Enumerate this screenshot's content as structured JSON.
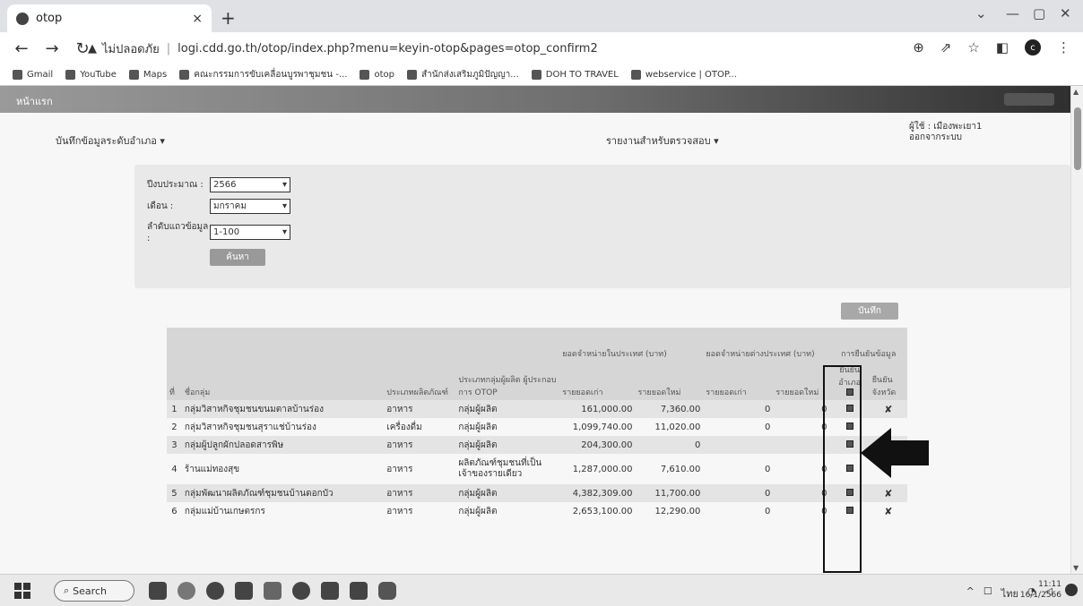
{
  "browser": {
    "tab_title": "otop",
    "close_glyph": "×",
    "new_tab_glyph": "+",
    "url_warning": "ไม่ปลอดภัย",
    "url": "logi.cdd.go.th/otop/index.php?menu=keyin-otop&pages=otop_confirm2",
    "profile_initial": "c"
  },
  "bookmarks": [
    {
      "label": "Gmail"
    },
    {
      "label": "YouTube"
    },
    {
      "label": "Maps"
    },
    {
      "label": "คณะกรรมการขับเคลื่อนบูรพาชุมชน -..."
    },
    {
      "label": "otop"
    },
    {
      "label": "สำนักส่งเสริมภูมิปัญญา..."
    },
    {
      "label": "DOH TO TRAVEL"
    },
    {
      "label": "webservice | OTOP..."
    }
  ],
  "header": {
    "home_label": "หน้าแรก"
  },
  "menu": {
    "left": "บันทึกข้อมูลระดับอำเภอ ▾",
    "center": "รายงานสำหรับตรวจสอบ ▾"
  },
  "user": {
    "line1": "ผู้ใช้ : เมืองพะเยา1",
    "line2": "ออกจากระบบ"
  },
  "filter": {
    "year_label": "ปีงบประมาณ :",
    "year_value": "2566",
    "month_label": "เดือน :",
    "month_value": "มกราคม",
    "range_label": "ลำดับแถวข้อมูล :",
    "range_value": "1-100",
    "search_button": "ค้นหา"
  },
  "save_button": "บันทึก",
  "table": {
    "group_headers": {
      "sales_group": "ยอดจำหน่ายในประเทศ (บาท)",
      "export_group": "ยอดจำหน่ายต่างประเทศ (บาท)",
      "confirm_group": "การยืนยันข้อมูล"
    },
    "headers": [
      "ที่",
      "ชื่อกลุ่ม",
      "ประเภทผลิตภัณฑ์",
      "ประเภทกลุ่มผู้ผลิต ผู้ประกอบการ OTOP",
      "รายยอดเก่า",
      "รายยอดใหม่",
      "รายยอดเก่า",
      "รายยอดใหม่",
      "ยืนยัน อำเภอ",
      "ยืนยัน จังหวัด"
    ],
    "rows": [
      {
        "no": "1",
        "name": "กลุ่มวิสาหกิจชุมชนขนมตาลบ้านร่อง",
        "type": "อาหาร",
        "producer": "กลุ่มผู้ผลิต",
        "old_sales": "161,000.00",
        "new_sales": "7,360.00",
        "exp_old": "0",
        "exp_new": "0",
        "prov": "✘"
      },
      {
        "no": "2",
        "name": "กลุ่มวิสาหกิจชุมชนสุราแช่บ้านร่อง",
        "type": "เครื่องดื่ม",
        "producer": "กลุ่มผู้ผลิต",
        "old_sales": "1,099,740.00",
        "new_sales": "11,020.00",
        "exp_old": "0",
        "exp_new": "0",
        "prov": ""
      },
      {
        "no": "3",
        "name": "กลุ่มผู้ปลูกผักปลอดสารพิษ",
        "type": "อาหาร",
        "producer": "กลุ่มผู้ผลิต",
        "old_sales": "204,300.00",
        "new_sales": "0",
        "exp_old": "",
        "exp_new": "",
        "prov": ""
      },
      {
        "no": "4",
        "name": "ร้านแม่ทองสุข",
        "type": "อาหาร",
        "producer": "ผลิตภัณฑ์ชุมชนที่เป็นเจ้าของรายเดียว",
        "old_sales": "1,287,000.00",
        "new_sales": "7,610.00",
        "exp_old": "0",
        "exp_new": "0",
        "prov": "✘"
      },
      {
        "no": "5",
        "name": "กลุ่มพัฒนาผลิตภัณฑ์ชุมชนบ้านดอกบัว",
        "type": "อาหาร",
        "producer": "กลุ่มผู้ผลิต",
        "old_sales": "4,382,309.00",
        "new_sales": "11,700.00",
        "exp_old": "0",
        "exp_new": "0",
        "prov": "✘"
      },
      {
        "no": "6",
        "name": "กลุ่มแม่บ้านเกษตรกร",
        "type": "อาหาร",
        "producer": "กลุ่มผู้ผลิต",
        "old_sales": "2,653,100.00",
        "new_sales": "12,290.00",
        "exp_old": "0",
        "exp_new": "0",
        "prov": "✘"
      }
    ]
  },
  "taskbar": {
    "search_label": "Search",
    "time": "11:11",
    "date": "16/1/2566",
    "lang": "ไทย"
  }
}
